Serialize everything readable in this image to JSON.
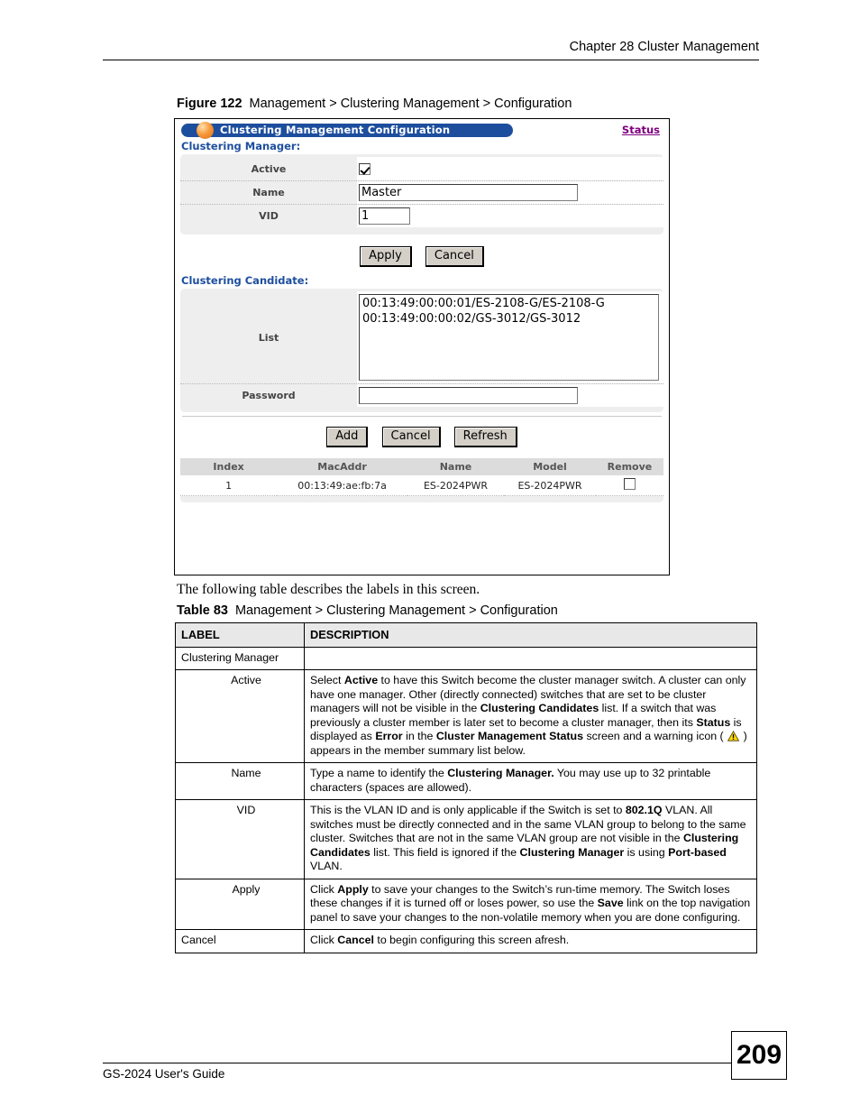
{
  "header": {
    "chapter": "Chapter 28 Cluster Management"
  },
  "figure": {
    "number": "Figure 122",
    "title": "Management > Clustering Management > Configuration"
  },
  "screenshot": {
    "titlebar": {
      "title": "Clustering Management Configuration",
      "status_link": "Status",
      "pill_color": "#1d4e9e",
      "orb_color": "#f79a3c",
      "link_color": "#800080"
    },
    "manager_section": {
      "label": "Clustering Manager:",
      "label_color": "#1d4e9e",
      "rows": {
        "active_label": "Active",
        "active_checked": true,
        "name_label": "Name",
        "name_value": "Master",
        "vid_label": "VID",
        "vid_value": "1"
      },
      "buttons": {
        "apply": "Apply",
        "cancel": "Cancel"
      }
    },
    "candidate_section": {
      "label": "Clustering Candidate:",
      "list_label": "List",
      "list_value": "00:13:49:00:00:01/ES-2108-G/ES-2108-G\n00:13:49:00:00:02/GS-3012/GS-3012",
      "password_label": "Password",
      "password_value": "",
      "buttons": {
        "add": "Add",
        "cancel": "Cancel",
        "refresh": "Refresh"
      }
    },
    "summary_table": {
      "columns": [
        "Index",
        "MacAddr",
        "Name",
        "Model",
        "Remove"
      ],
      "rows": [
        {
          "index": "1",
          "macaddr": "00:13:49:ae:fb:7a",
          "name": "ES-2024PWR",
          "model": "ES-2024PWR",
          "remove_checked": false
        }
      ]
    }
  },
  "prose": {
    "intro": "The following table describes the labels in this screen."
  },
  "table": {
    "number": "Table 83",
    "title": "Management > Clustering Management > Configuration",
    "columns": {
      "label": "LABEL",
      "description": "DESCRIPTION"
    },
    "rows": [
      {
        "label": "Clustering Manager",
        "indent": false,
        "description_html": ""
      },
      {
        "label": "Active",
        "indent": true,
        "description_html": "Select <b>Active</b> to have this Switch become the cluster manager switch. A cluster can only have one manager. Other (directly connected) switches that are set to be cluster managers will not be visible in the <b>Clustering Candidates</b> list. If a switch that was previously a cluster member is later set to become a cluster manager, then its <b>Status</b> is displayed as <b>Error</b> in the <b>Cluster Management Status</b> screen and a warning icon ( @WARN@ ) appears in the member summary list below."
      },
      {
        "label": "Name",
        "indent": true,
        "description_html": "Type a name to identify the <b>Clustering Manager.</b> You may use up to 32 printable characters (spaces are allowed)."
      },
      {
        "label": "VID",
        "indent": true,
        "description_html": "This is the VLAN ID and is only applicable if the Switch is set to <b>802.1Q</b> VLAN. All switches must be directly connected and in the same VLAN group to belong to the same cluster. Switches that are not in the same VLAN group are not visible in the <b>Clustering Candidates</b> list. This field is ignored if the <b>Clustering Manager</b> is using <b>Port-based</b> VLAN."
      },
      {
        "label": "Apply",
        "indent": true,
        "description_html": "Click <b>Apply</b> to save your changes to the Switch&rsquo;s run-time memory. The Switch loses these changes if it is turned off or loses power, so use the <b>Save</b> link on the top navigation panel to save your changes to the non-volatile memory when you are done configuring."
      },
      {
        "label": "Cancel",
        "indent": false,
        "description_html": "Click <b>Cancel</b> to begin configuring this screen afresh."
      }
    ]
  },
  "footer": {
    "guide": "GS-2024 User's Guide",
    "page": "209"
  }
}
